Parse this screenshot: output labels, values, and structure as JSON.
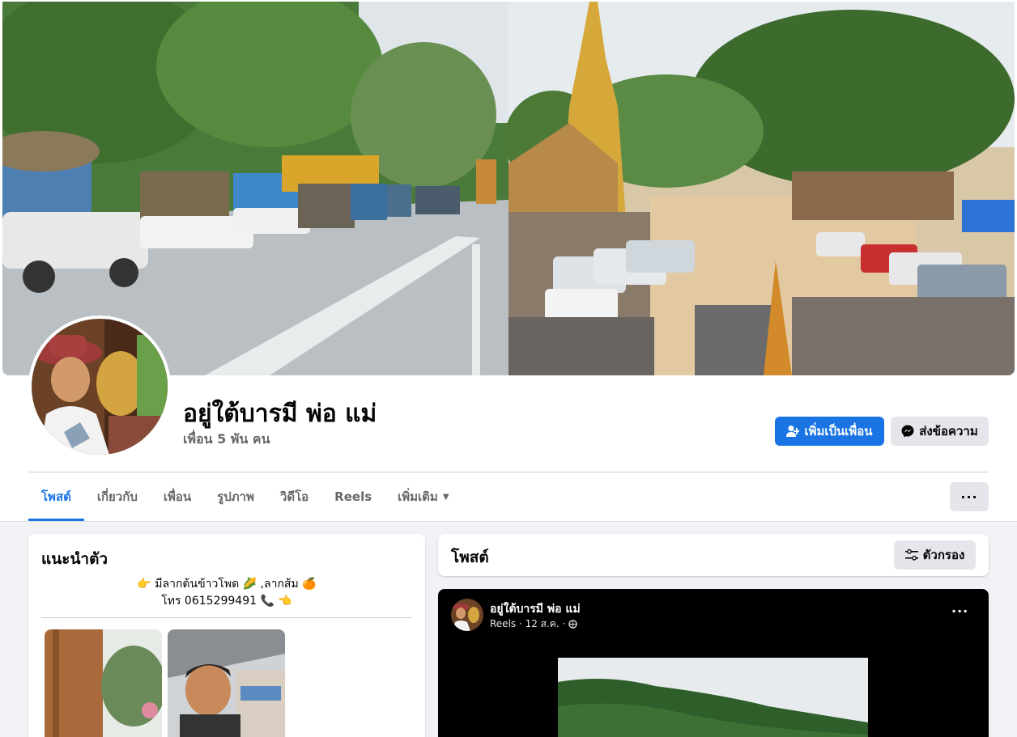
{
  "profile": {
    "name": "อยู่ใต้บารมี พ่อ แม่",
    "friends": "เพื่อน 5 พัน คน"
  },
  "actions": {
    "add_friend": "เพิ่มเป็นเพื่อน",
    "message": "ส่งข้อความ",
    "more": "···"
  },
  "tabs": [
    {
      "label": "โพสต์",
      "active": true
    },
    {
      "label": "เกี่ยวกับ"
    },
    {
      "label": "เพื่อน"
    },
    {
      "label": "รูปภาพ"
    },
    {
      "label": "วิดีโอ"
    },
    {
      "label": "Reels"
    },
    {
      "label": "เพิ่มเติม"
    }
  ],
  "intro": {
    "title": "แนะนำตัว",
    "bio_line1": "👉 มีลากต้นข้าวโพด 🌽 ,ลากส้ม 🍊",
    "bio_line2": "โทร 0615299491 📞 👈"
  },
  "posts_section": {
    "title": "โพสต์",
    "filter_label": "ตัวกรอง"
  },
  "post": {
    "author": "อยู่ใต้บารมี พ่อ แม่",
    "meta": "Reels · 12 ส.ค. ·",
    "more": "···"
  },
  "colors": {
    "primary": "#1b74e4",
    "background": "#f0f2f5",
    "secondary_button": "#e4e6eb",
    "muted_text": "#65676b"
  }
}
